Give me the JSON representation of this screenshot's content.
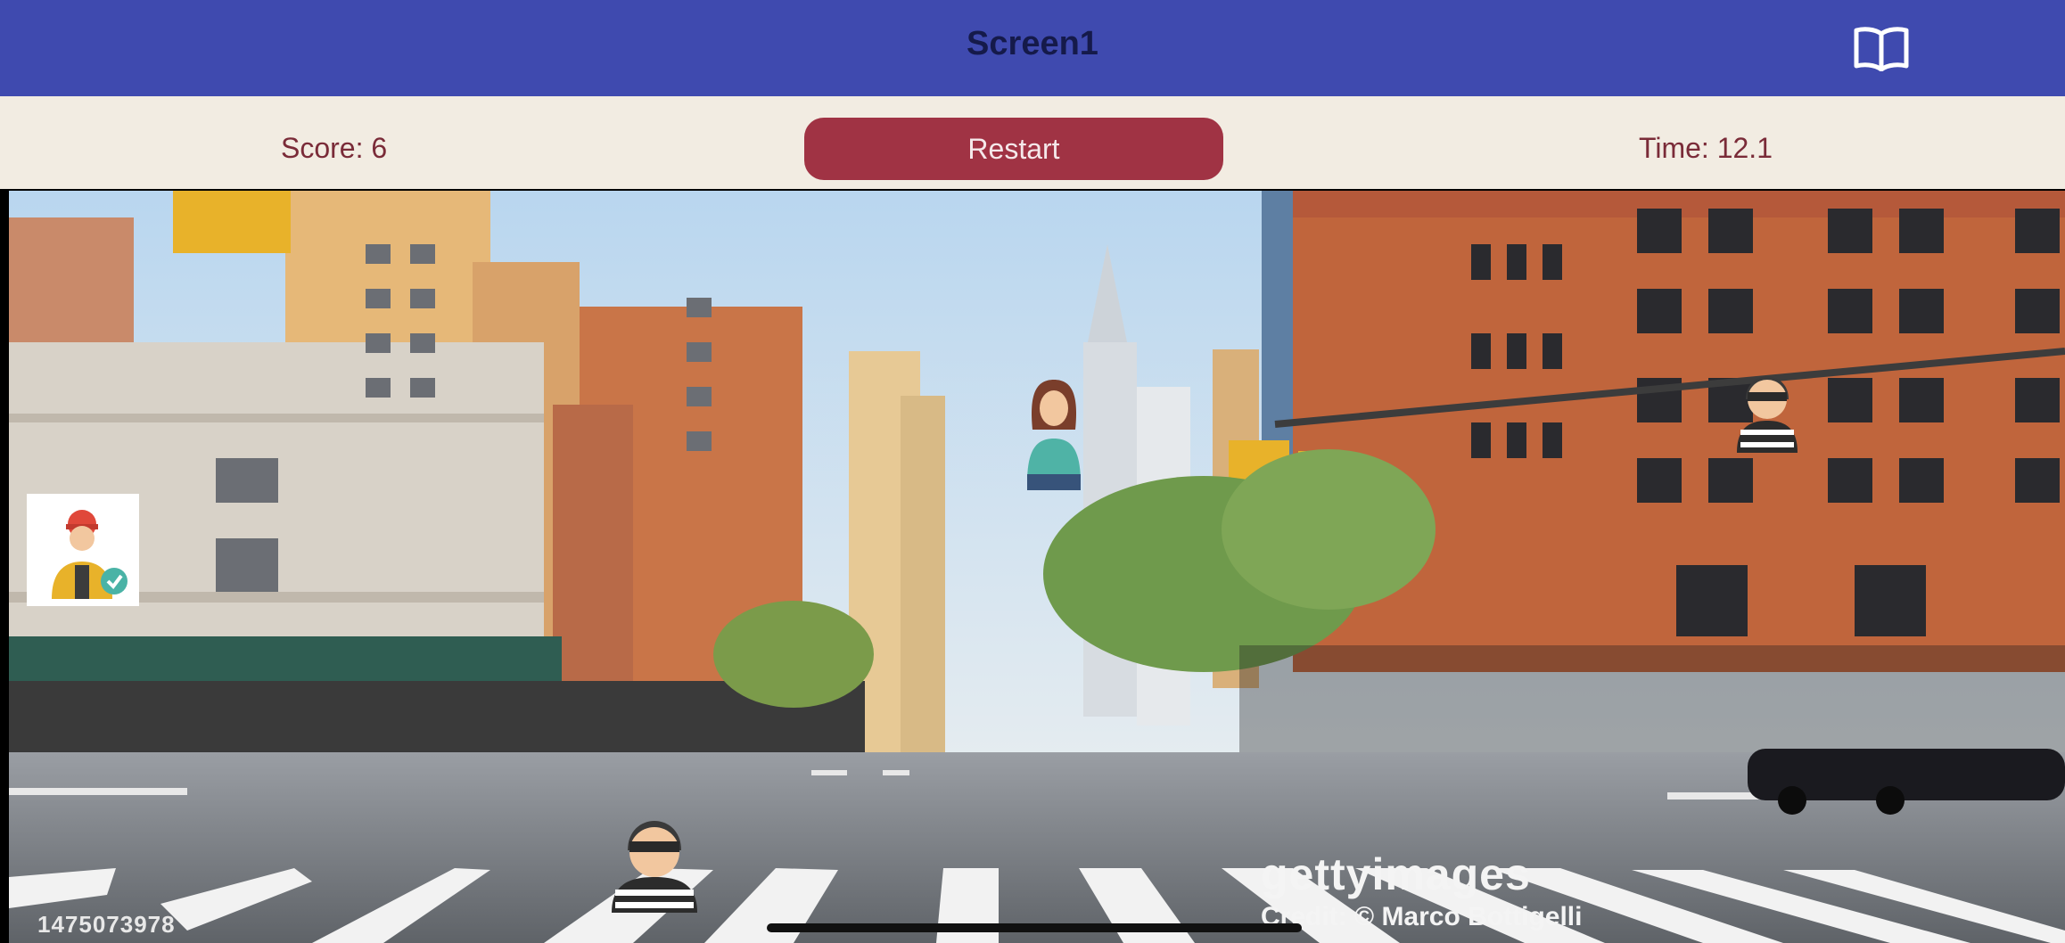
{
  "titlebar": {
    "title": "Screen1",
    "book_icon": "book-icon"
  },
  "hud": {
    "score": "Score: 6",
    "restart_label": "Restart",
    "time": "Time: 12.1"
  },
  "scene": {
    "background": "new-york-street-photo",
    "watermark_brand": "gettyimages",
    "watermark_credit": "Credit: © Marco Bottigelli",
    "photo_id": "1475073978"
  },
  "sprites": {
    "worker": "construction-worker-icon",
    "woman": "woman-pedestrian-icon",
    "thief_top": "masked-thief-icon",
    "thief_player": "masked-thief-player-icon"
  },
  "colors": {
    "header": "#3f4aaf",
    "hud": "#f2ece2",
    "button": "#a03344",
    "text": "#7a2b38"
  }
}
